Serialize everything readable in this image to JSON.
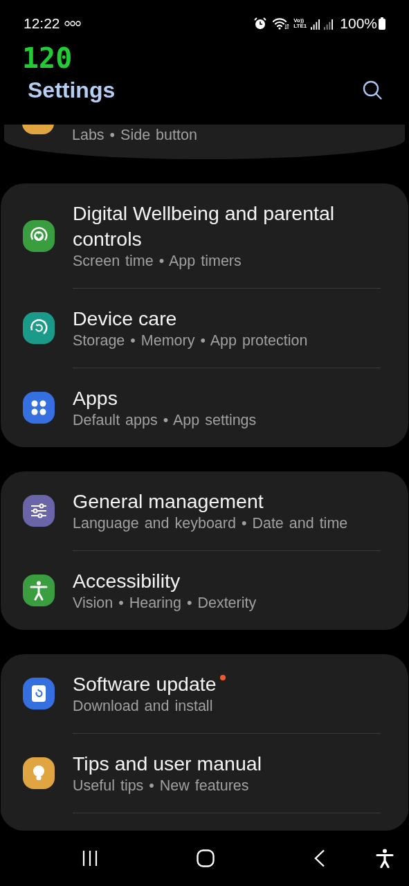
{
  "status_bar": {
    "time": "12:22",
    "volte_top": "Vo))",
    "volte_bottom": "LTE1",
    "battery": "100%"
  },
  "refresh_counter": "120",
  "header": {
    "title": "Settings"
  },
  "partial_item": {
    "subtitle": "Labs • Side button",
    "color": "#e0a540"
  },
  "groups": [
    {
      "continues": false,
      "items": [
        {
          "kind": "wellbeing",
          "color": "#3a9d3f",
          "title": "Digital Wellbeing and parental controls",
          "subtitle": "Screen time • App timers",
          "badge": false
        },
        {
          "kind": "devicecare",
          "color": "#1a9a88",
          "title": "Device care",
          "subtitle": "Storage • Memory • App protection",
          "badge": false
        },
        {
          "kind": "apps",
          "color": "#3670e0",
          "title": "Apps",
          "subtitle": "Default apps • App settings",
          "badge": false
        }
      ]
    },
    {
      "continues": false,
      "items": [
        {
          "kind": "sliders",
          "color": "#6a64a8",
          "title": "General management",
          "subtitle": "Language and keyboard • Date and time",
          "badge": false
        },
        {
          "kind": "accessibility",
          "color": "#3a9d3f",
          "title": "Accessibility",
          "subtitle": "Vision • Hearing • Dexterity",
          "badge": false
        }
      ]
    },
    {
      "continues": true,
      "items": [
        {
          "kind": "update",
          "color": "#3670e0",
          "title": "Software update",
          "subtitle": "Download and install",
          "badge": true
        },
        {
          "kind": "bulb",
          "color": "#e0a540",
          "title": "Tips and user manual",
          "subtitle": "Useful tips • New features",
          "badge": false
        }
      ]
    }
  ]
}
